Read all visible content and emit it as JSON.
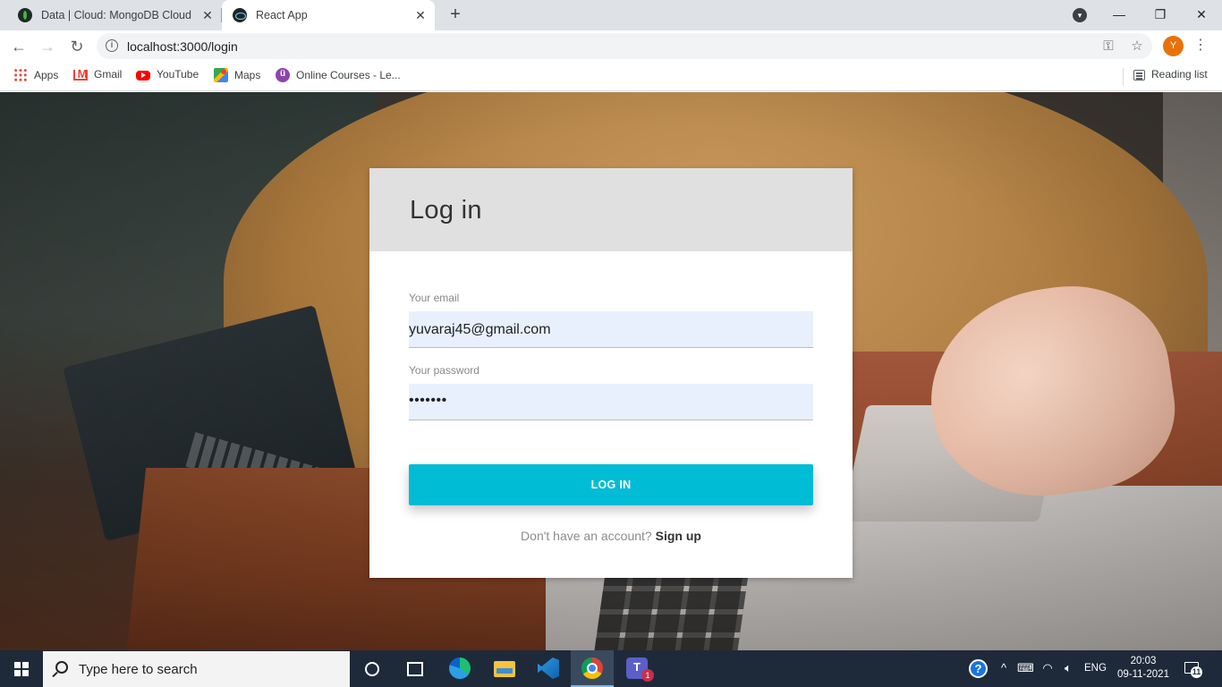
{
  "browser": {
    "tabs": [
      {
        "title": "Data | Cloud: MongoDB Cloud",
        "icon": "mongodb-leaf-icon",
        "active": false
      },
      {
        "title": "React App",
        "icon": "react-logo-icon",
        "active": true
      }
    ],
    "address_bar": {
      "url": "localhost:3000/login"
    },
    "profile_initial": "Y",
    "bookmarks": [
      {
        "label": "Apps",
        "icon": "apps-grid-icon"
      },
      {
        "label": "Gmail",
        "icon": "gmail-icon"
      },
      {
        "label": "YouTube",
        "icon": "youtube-icon"
      },
      {
        "label": "Maps",
        "icon": "maps-icon"
      },
      {
        "label": "Online Courses - Le...",
        "icon": "courses-icon"
      }
    ],
    "reading_list_label": "Reading list"
  },
  "login": {
    "title": "Log in",
    "email_label": "Your email",
    "email_value": "yuvaraj45@gmail.com",
    "password_label": "Your password",
    "password_value": "•••••••",
    "button_label": "LOG IN",
    "signup_prompt": "Don't have an account?",
    "signup_link": "Sign up",
    "accent_color": "#00bcd4"
  },
  "taskbar": {
    "search_placeholder": "Type here to search",
    "pinned_apps": [
      "cortana",
      "task-view",
      "edge",
      "file-explorer",
      "vscode",
      "chrome",
      "teams"
    ],
    "teams_badge": "1",
    "language": "ENG",
    "time": "20:03",
    "date": "09-11-2021",
    "notification_count": "11"
  }
}
